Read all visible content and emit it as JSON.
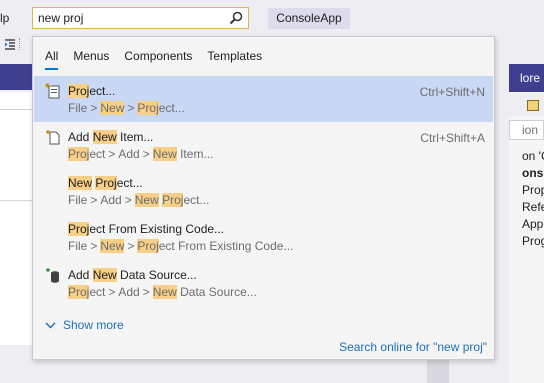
{
  "titlebar": {
    "menu_help_fragment": "lp",
    "search": {
      "value": "new proj"
    },
    "solution_name": "ConsoleApp"
  },
  "right_panel": {
    "header_fragment": "lore",
    "search_fragment": "ion",
    "tree": [
      "on 'C",
      "onsole",
      "Prop",
      "Refe",
      "App",
      "Prog"
    ]
  },
  "dropdown": {
    "tabs": [
      {
        "label": "All",
        "active": true
      },
      {
        "label": "Menus"
      },
      {
        "label": "Components"
      },
      {
        "label": "Templates"
      }
    ],
    "results": [
      {
        "icon": "project-icon",
        "title": [
          {
            "t": "Proj",
            "h": true
          },
          {
            "t": "ect..."
          }
        ],
        "path": [
          [
            {
              "t": "File"
            }
          ],
          [
            {
              "t": "New",
              "h": true
            }
          ],
          [
            {
              "t": "Proj",
              "h": true
            },
            {
              "t": "ect..."
            }
          ]
        ],
        "shortcut": "Ctrl+Shift+N",
        "selected": true
      },
      {
        "icon": "add-new-item-icon",
        "title": [
          {
            "t": "Add "
          },
          {
            "t": "New",
            "h": true
          },
          {
            "t": " Item..."
          }
        ],
        "path": [
          [
            {
              "t": "Proj",
              "h": true
            },
            {
              "t": "ect"
            }
          ],
          [
            {
              "t": "Add"
            }
          ],
          [
            {
              "t": "New",
              "h": true
            },
            {
              "t": " Item..."
            }
          ]
        ],
        "shortcut": "Ctrl+Shift+A"
      },
      {
        "icon": "",
        "title": [
          {
            "t": "New",
            "h": true
          },
          {
            "t": " "
          },
          {
            "t": "Proj",
            "h": true
          },
          {
            "t": "ect..."
          }
        ],
        "path": [
          [
            {
              "t": "File"
            }
          ],
          [
            {
              "t": "Add"
            }
          ],
          [
            {
              "t": "New",
              "h": true
            },
            {
              "t": " "
            },
            {
              "t": "Proj",
              "h": true
            },
            {
              "t": "ect..."
            }
          ]
        ],
        "shortcut": ""
      },
      {
        "icon": "",
        "title": [
          {
            "t": "Proj",
            "h": true
          },
          {
            "t": "ect From Existing Code..."
          }
        ],
        "path": [
          [
            {
              "t": "File"
            }
          ],
          [
            {
              "t": "New",
              "h": true
            }
          ],
          [
            {
              "t": "Proj",
              "h": true
            },
            {
              "t": "ect From Existing Code..."
            }
          ]
        ],
        "shortcut": ""
      },
      {
        "icon": "add-data-source-icon",
        "title": [
          {
            "t": "Add "
          },
          {
            "t": "New",
            "h": true
          },
          {
            "t": " Data Source..."
          }
        ],
        "path": [
          [
            {
              "t": "Proj",
              "h": true
            },
            {
              "t": "ect"
            }
          ],
          [
            {
              "t": "Add"
            }
          ],
          [
            {
              "t": "New",
              "h": true
            },
            {
              "t": " Data Source..."
            }
          ]
        ],
        "shortcut": ""
      }
    ],
    "show_more_label": "Show more",
    "search_online_label": "Search online for \"new proj\""
  },
  "colors": {
    "highlight": "#f7cf86",
    "selected_row": "#c9d8f5",
    "link": "#1b6fb8",
    "accent": "#007acc",
    "panel_header": "#3f3f8f"
  }
}
